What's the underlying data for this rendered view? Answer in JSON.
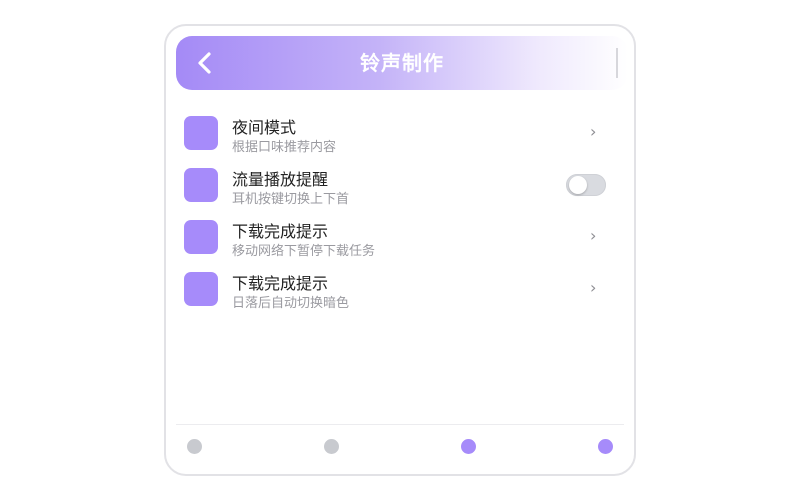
{
  "header": {
    "title": "铃声制作"
  },
  "settings": [
    {
      "title": "夜间模式",
      "subtitle": "根据口味推荐内容",
      "control": "chevron",
      "chevron": "›",
      "icon_color": "#a68bfa"
    },
    {
      "title": "流量播放提醒",
      "subtitle": "耳机按键切换上下首",
      "control": "toggle",
      "toggle_on": false,
      "icon_color": "#a68bfa"
    },
    {
      "title": "下载完成提示",
      "subtitle": "移动网络下暂停下载任务",
      "control": "chevron",
      "chevron": "›",
      "icon_color": "#a68bfa"
    },
    {
      "title": "下载完成提示",
      "subtitle": "日落后自动切换暗色",
      "control": "chevron",
      "chevron": "›",
      "icon_color": "#a68bfa"
    }
  ],
  "bottom_nav": {
    "dots": [
      {
        "color": "#c8cacf",
        "active": false
      },
      {
        "color": "#c8cacf",
        "active": false
      },
      {
        "color": "#a68bfa",
        "active": true
      },
      {
        "color": "#a68bfa",
        "active": true
      }
    ]
  },
  "colors": {
    "accent": "#a68bfa",
    "header_gradient_start": "#a48af6",
    "inactive_dot": "#c8cacf"
  }
}
